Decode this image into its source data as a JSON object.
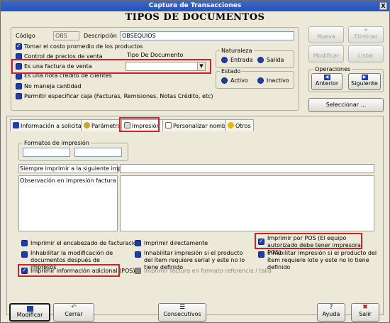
{
  "window": {
    "title": "Captura de Transacciones",
    "close_label": "X"
  },
  "header": {
    "title": "TIPOS DE DOCUMENTOS"
  },
  "form": {
    "codigo_label": "Código",
    "codigo_value": "OBS",
    "descripcion_label": "Descripción",
    "descripcion_value": "OBSEQUIOS",
    "options": [
      {
        "label": "Tomar el costo promedio de los productos",
        "checked": true
      },
      {
        "label": "Control de precios de venta",
        "checked": false
      },
      {
        "label": "Es una factura de venta",
        "checked": false
      },
      {
        "label": "Es una nota crédito de clientes",
        "checked": false
      },
      {
        "label": "No maneja cantidad",
        "checked": false
      },
      {
        "label": "Permitir especificar caja  (Facturas, Remisiones, Notas Crédito, etc)",
        "checked": false
      }
    ],
    "tipo_documento_label": "Tipo De Documento",
    "tipo_documento_value": "",
    "naturaleza": {
      "label": "Naturaleza",
      "options": [
        "Entrada",
        "Salida"
      ]
    },
    "estado": {
      "label": "Estado",
      "options": [
        "Activo",
        "Inactivo"
      ]
    }
  },
  "actions": {
    "nueva": "Nueva",
    "eliminar": "Eliminar",
    "modificar": "Modificar",
    "listar": "Listar",
    "operaciones_label": "Operaciones",
    "anterior": "Anterior",
    "siguiente": "Siguiente",
    "seleccionar": "Seleccionar ..."
  },
  "tabs": [
    {
      "label": "Información a solicitar",
      "icon": "info-icon"
    },
    {
      "label": "Parámetros",
      "icon": "gear-icon"
    },
    {
      "label": "Impresión",
      "icon": "print-icon",
      "active": true
    },
    {
      "label": "Personalizar nombres",
      "icon": "document-icon"
    },
    {
      "label": "Otros",
      "icon": "coin-icon"
    }
  ],
  "impresion": {
    "formatos_label": "Formatos de impresión",
    "formato_1": "",
    "formato_2": "",
    "siempre_label": "Siempre imprimir a la siguiente impresora",
    "siempre_value": "",
    "observacion_label": "Observación en impresión factura",
    "observacion_value": "",
    "checks": [
      {
        "label": "Imprimir el encabezado de facturación",
        "checked": false
      },
      {
        "label": "Inhabilitar la modificación de documentos después de impresos",
        "checked": false
      },
      {
        "label": "Imprimir información adicional (POS)",
        "checked": true
      },
      {
        "label": "Imprimir directamente",
        "checked": false
      },
      {
        "label": "Inhabilitar impresión si el producto del ítem requiere serial y este no lo tiene definido",
        "checked": false
      },
      {
        "label": "Imprimir factura en formato referencia / talla",
        "checked": false
      },
      {
        "label": "Imprimir por POS (El equipo autorizado debe tener impresora POS)",
        "checked": true
      },
      {
        "label": "Inhabilitar impresión si el producto del ítem requiere lote y este no lo tiene definido",
        "checked": false
      }
    ]
  },
  "bottom": {
    "modificar": "Modificar",
    "cerrar": "Cerrar",
    "consecutivos": "Consecutivos",
    "ayuda": "Ayuda",
    "salir": "Salir"
  },
  "colors": {
    "highlight": "#d0202a",
    "check_blue": "#1f3fa8",
    "titlebar": "#2452b8"
  }
}
